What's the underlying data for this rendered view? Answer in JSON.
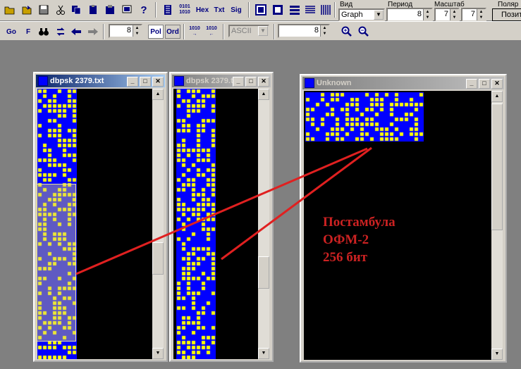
{
  "toolbar1": {
    "hex_label": "Hex",
    "txt_label": "Txt",
    "sig_label": "Sig",
    "vid_label": "Вид",
    "vid_value": "Graph",
    "period_label": "Период",
    "period_value": "8",
    "scale_label": "Масштаб",
    "scale_value1": "7",
    "scale_value2": "7",
    "polar_label": "Поляр",
    "polar_button": "Позит"
  },
  "toolbar2": {
    "go_label": "Go",
    "f_label": "F",
    "spin1_value": "8",
    "pol_label": "Pol",
    "ord_label": "Ord",
    "encoding_value": "ASCII",
    "spin2_value": "8"
  },
  "windows": {
    "win1_title": "dbpsk 2379.txt",
    "win2_title": "dbpsk 2379.txt",
    "win3_title": "Unknown"
  },
  "annotation": {
    "line1": "Постамбула",
    "line2": "ОФМ-2",
    "line3": "256 бит"
  },
  "colors": {
    "bit_one": "#ffff00",
    "bit_zero": "#0000ff",
    "annotation": "#cc2222",
    "background": "#808080"
  }
}
